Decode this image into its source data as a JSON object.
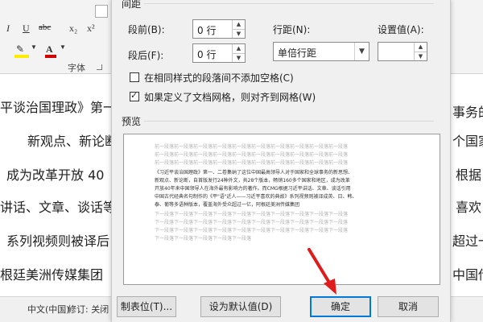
{
  "ribbon": {
    "font_group_label": "字体",
    "buttons_row1": [
      "I",
      "U",
      "abc",
      "x₂",
      "x²"
    ],
    "highlight_color": "#ffeb00",
    "font_color": "#d00000"
  },
  "document": {
    "lines": [
      "平谈治国理政》第一",
      "新观点、新论断,",
      "成为改革开放 40",
      "讲话、文章、谈话等",
      "系列视频则被译后",
      "根廷美洲传媒集团",
      "事务的",
      "个国家",
      "根据",
      "喜欢",
      "超过一",
      "中国传"
    ]
  },
  "statusbar": {
    "language": "中文(中国)",
    "track_changes": "修订: 关闭"
  },
  "dialog": {
    "spacing_title": "间距",
    "before_label": "段前(B):",
    "before_value": "0 行",
    "after_label": "段后(F):",
    "after_value": "0 行",
    "line_spacing_label": "行距(N):",
    "line_spacing_value": "单倍行距",
    "set_value_label": "设置值(A):",
    "set_value_value": "",
    "checkbox_no_space": {
      "label": "在相同样式的段落间不添加空格(C)",
      "checked": false
    },
    "checkbox_snap_grid": {
      "label": "如果定义了文档网格，则对齐到网格(W)",
      "checked": true
    },
    "preview_title": "预览",
    "preview": {
      "prev_para_lines": [
        "前一段落前一段落前一段落前一段落前一段落前一段落前一段落前一段落前一段落前一段落",
        "前一段落前一段落前一段落前一段落前一段落前一段落前一段落前一段落前一段落前一段落",
        "前一段落前一段落前一段落前一段落前一段落前一段落前一段落前一段落前一段落前一段落"
      ],
      "sample_lines": [
        "《习近平谈治国理政》第一、二卷集纳了这位中国最高领导人对于国家和全球事务的新思想、",
        "新观点、新论断，自首版发行24种外文，共28个版本，畅销160多个国家和地区，成为改革",
        "开放40年来中国领导人在海外最有影响力的著作。而CMG根据习近平讲话、文章、谈话引用",
        "中国古代经典名句制作的《平\"语\"近人——习近平喜欢的典故》系列视频则被译成英、日、韩、",
        "泰、葡等多语种版本，覆盖海外受众超过一亿，阿根廷美洲传媒集团"
      ],
      "next_para_lines": [
        "下一段落下一段落下一段落下一段落下一段落下一段落下一段落下一段落下一段落下一段落",
        "下一段落下一段落下一段落下一段落下一段落下一段落下一段落下一段落下一段落下一段落",
        "下一段落下一段落下一段落下一段落下一段落下一段落下一段落下一段落下一段落下一段落",
        "下一段落下一段落下一段落下一段落下一段落"
      ]
    },
    "tabs_button": "制表位(T)...",
    "default_button": "设为默认值(D)",
    "ok_button": "确定",
    "cancel_button": "取消"
  },
  "annotation_arrow_color": "#e01b1b"
}
